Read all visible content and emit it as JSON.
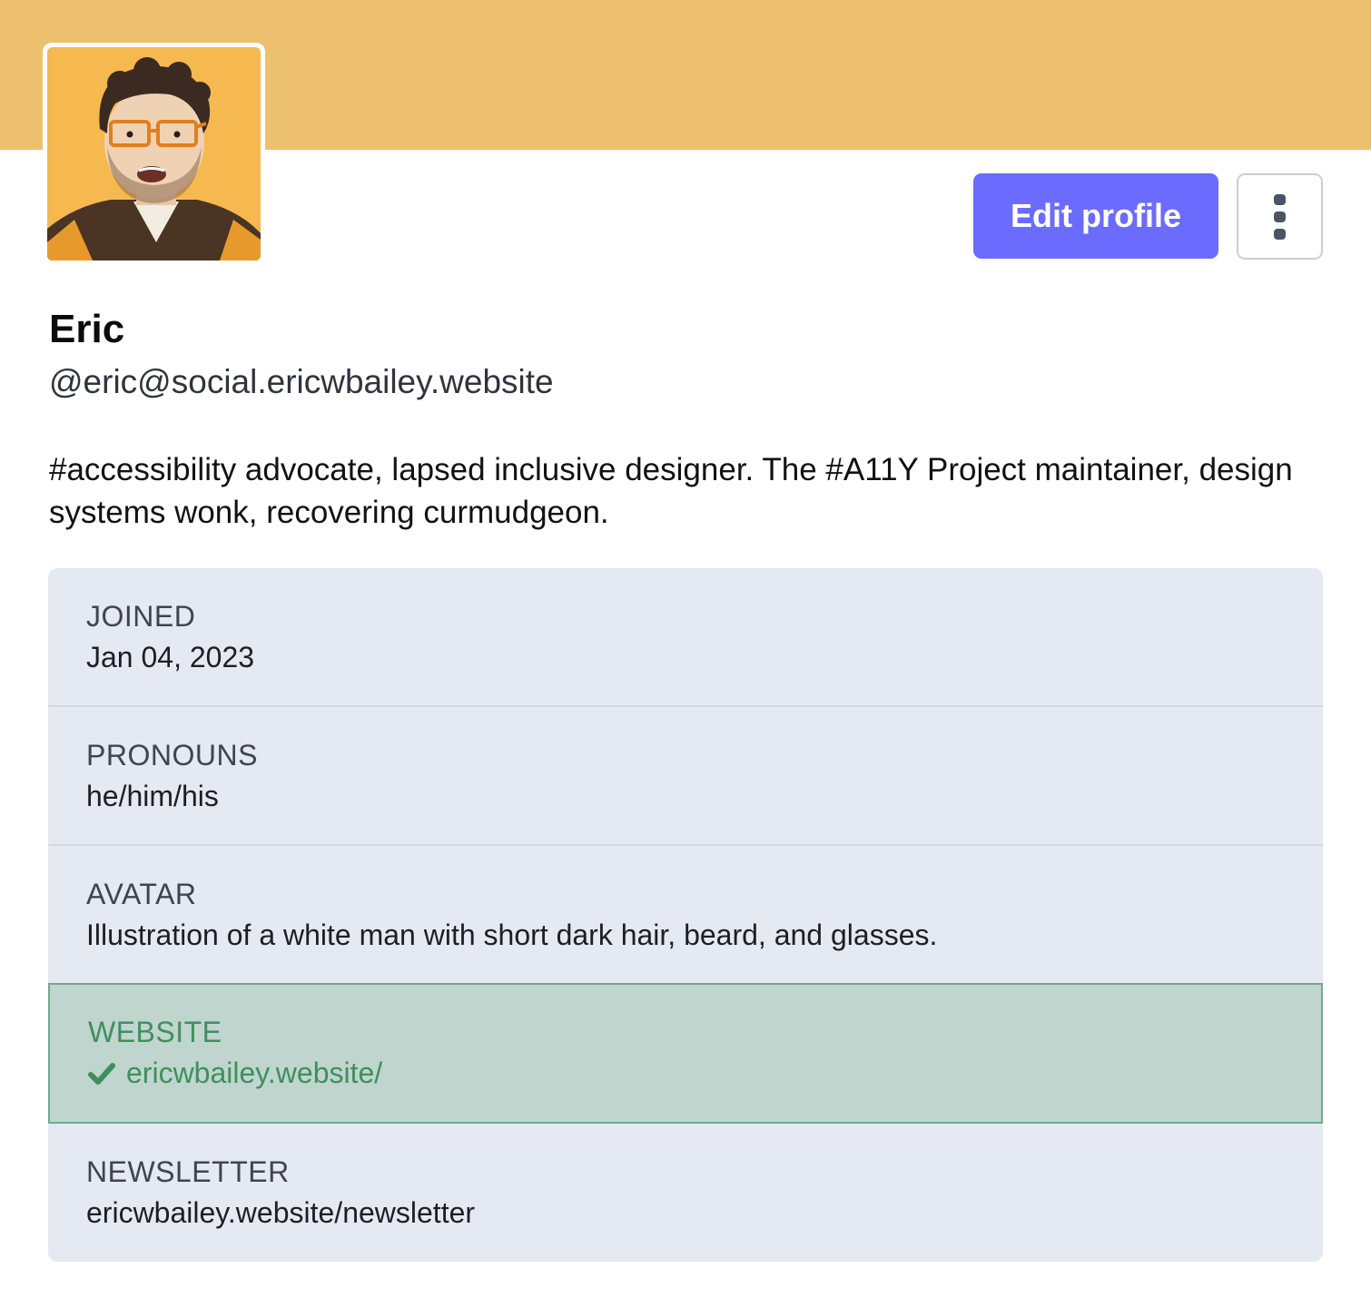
{
  "profile": {
    "name": "Eric",
    "handle": "@eric@social.ericwbailey.website",
    "bio": "#accessibility advocate, lapsed inclusive designer. The #A11Y Project maintainer, design systems wonk, recovering curmudgeon."
  },
  "actions": {
    "edit_label": "Edit profile",
    "more_icon": "vertical-ellipsis-icon"
  },
  "fields": [
    {
      "label": "JOINED",
      "value": "Jan 04, 2023"
    },
    {
      "label": "PRONOUNS",
      "value": "he/him/his"
    },
    {
      "label": "AVATAR",
      "value": "Illustration of a white man with short dark hair, beard, and glasses."
    },
    {
      "label": "WEBSITE",
      "value": "ericwbailey.website/",
      "verified": true,
      "icon": "checkmark-icon"
    },
    {
      "label": "NEWSLETTER",
      "value": "ericwbailey.website/newsletter"
    }
  ],
  "colors": {
    "banner": "#ecc06f",
    "accent": "#6b6cfe",
    "verified": "#3f8f5e",
    "link": "#3b3fe0",
    "fields_bg": "#e5e9f1"
  }
}
